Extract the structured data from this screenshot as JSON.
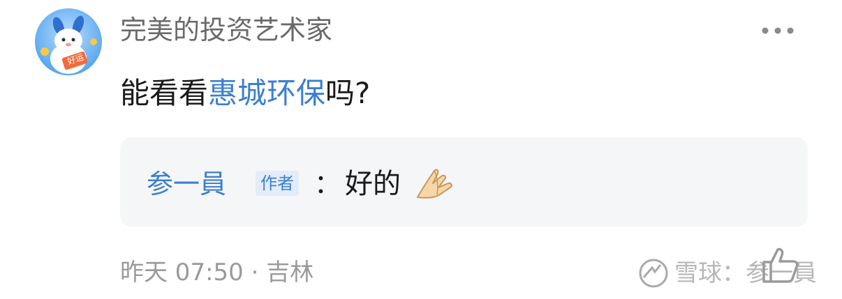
{
  "post": {
    "avatar_icon": "lucky-mascot-avatar-icon",
    "avatar_badge_text": "好运",
    "username": "完美的投资艺术家",
    "content_prefix": "能看看",
    "content_stock": "惠城环保",
    "content_suffix": "吗?",
    "timestamp": "昨天 07:50",
    "separator": "·",
    "location": "吉林"
  },
  "reply": {
    "author": "参一員",
    "badge": "作者",
    "colon": "：",
    "text": "好的",
    "emoji_icon": "praying-hands-icon"
  },
  "actions": {
    "more_icon": "more-dots-icon",
    "like_icon": "thumbs-up-icon"
  },
  "watermark": {
    "logo_icon": "snowball-logo-icon",
    "text": "雪球：参一員"
  },
  "colors": {
    "link": "#3b7fd1",
    "text": "#1a1a1a",
    "muted": "#9a9a9a",
    "reply_bg": "#f5f6f8"
  }
}
